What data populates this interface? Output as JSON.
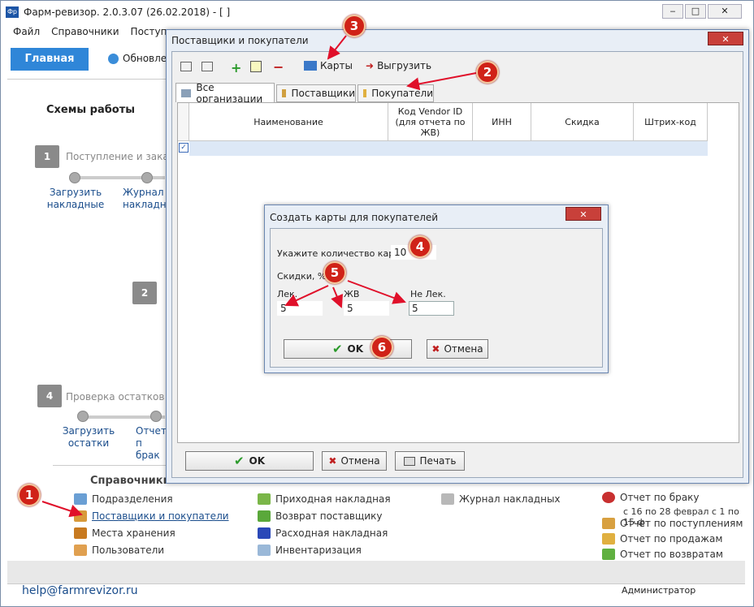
{
  "app": {
    "title": "Фарм-ревизор. 2.0.3.07 (26.02.2018) - [ ]",
    "logo": "Фр"
  },
  "menu": [
    "Файл",
    "Справочники",
    "Поступле"
  ],
  "toolbar": {
    "home": "Главная",
    "update": "Обновлен"
  },
  "schemes": {
    "title": "Схемы работы",
    "step1_num": "1",
    "step1_text": "Поступление и заказ",
    "step1_a1": "Загрузить",
    "step1_a2": "накладные",
    "step1_b1": "Журнал",
    "step1_b2": "накладны",
    "step2_num": "2",
    "step4_num": "4",
    "step4_text": "Проверка остатков н",
    "step4_a1": "Загрузить",
    "step4_a2": "остатки",
    "step4_b1": "Отчет п",
    "step4_b2": "брак"
  },
  "refs": {
    "title": "Справочники",
    "items": [
      "Подразделения",
      "Поставщики и покупатели",
      "Места хранения",
      "Пользователи"
    ],
    "col2": [
      "Приходная накладная",
      "Возврат поставщику",
      "Расходная накладная",
      "Инвентаризация"
    ],
    "col3": [
      "Журнал накладных"
    ],
    "col4": [
      "Отчет по браку",
      "с 16 по 28 феврал с 1 по 15 ф",
      "Отчет по поступлениям",
      "Отчет по продажам",
      "Отчет по возвратам"
    ]
  },
  "status": {
    "email": "help@farmrevizor.ru",
    "user": "Администратор"
  },
  "supWin": {
    "title": "Поставщики и покупатели",
    "cards": "Карты",
    "export": "Выгрузить",
    "tabs": [
      "Все организации",
      "Поставщики",
      "Покупатели"
    ],
    "columns": [
      "Наименование",
      "Код Vendor ID (для отчета по ЖВ)",
      "ИНН",
      "Скидка",
      "Штрих-код"
    ],
    "ok": "OK",
    "cancel": "Отмена",
    "print": "Печать"
  },
  "dialog": {
    "title": "Создать карты для покупателей",
    "count_label": "Укажите количество карт",
    "count_value": "10",
    "discounts_label": "Скидки, %",
    "lek_label": "Лек.",
    "lek_value": "5",
    "zhv_label": "ЖВ",
    "zhv_value": "5",
    "nelek_label": "Не Лек.",
    "nelek_value": "5",
    "ok": "OK",
    "cancel": "Отмена"
  },
  "badges": [
    "1",
    "2",
    "3",
    "4",
    "5",
    "6"
  ],
  "colors": {
    "accent": "#2f86d8",
    "badge": "#d02218",
    "arrow": "#e0102a"
  }
}
